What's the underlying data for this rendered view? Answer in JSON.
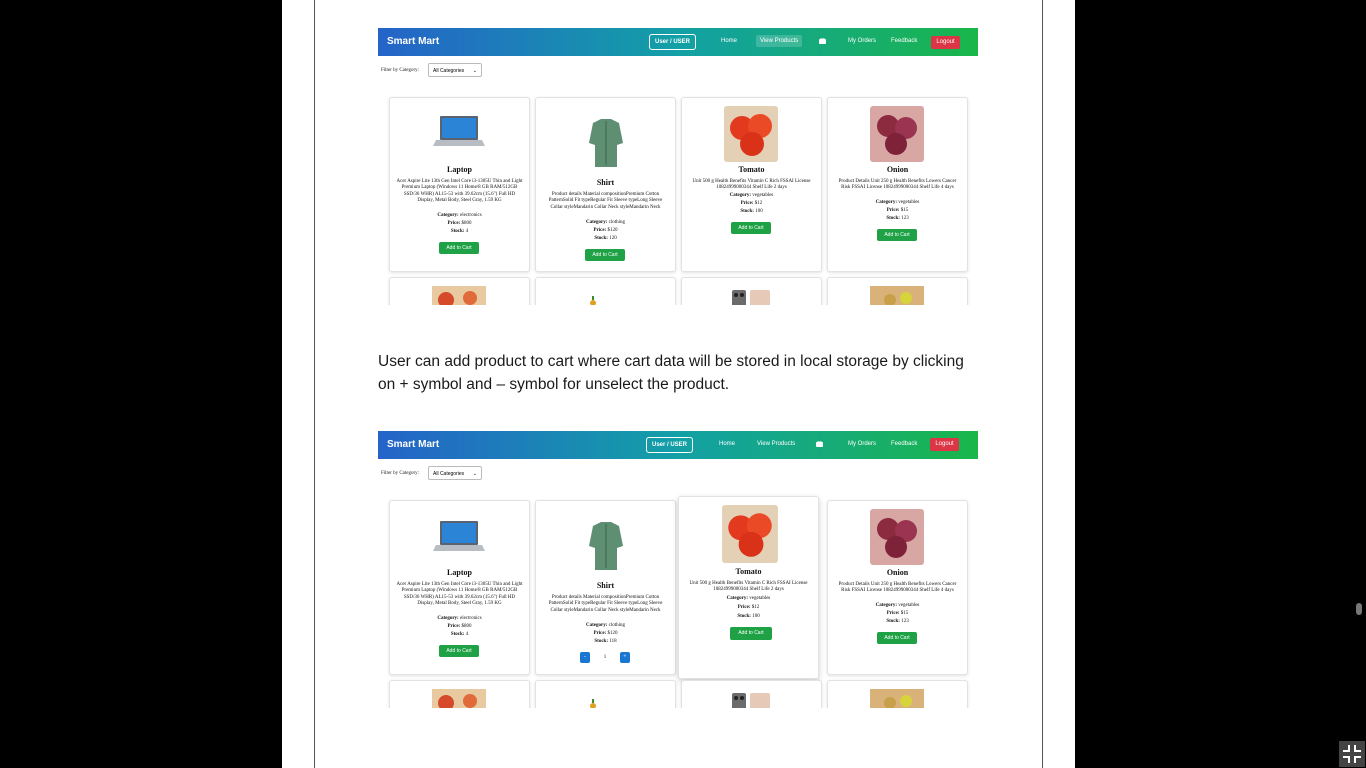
{
  "paragraph": {
    "line1": "User can add product to cart where cart data will be stored in local storage by clicking",
    "line2": "on + symbol and – symbol for unselect the product."
  },
  "colors": {
    "nav_gradient": [
      "#2563c9",
      "#13a0a6",
      "#19b64a"
    ],
    "add_to_cart": "#1fa246",
    "logout": "#dc3545",
    "qty_button": "#1976d2"
  },
  "screenshots": [
    {
      "brand": "Smart Mart",
      "nav_user": "User / USER",
      "nav_home": "Home",
      "nav_view_products": "View Products",
      "nav_my_orders": "My Orders",
      "nav_feedback": "Feedback",
      "nav_logout": "Logout",
      "filter_label": "Filter by Category:",
      "filter_value": "All Categories",
      "products": [
        {
          "name": "Laptop",
          "desc": "Acer Aspire Lite 13th Gen Intel Core i3-1305U Thin and Light Premium Laptop (Windows 11 Home/8 GB RAM/512GB SSD/36 WHR) AL15-53 with 39.62cm (15.6\") Full HD Display, Metal Body, Steel Gray, 1.59 KG",
          "category_label": "Category:",
          "category": "electronics",
          "price_label": "Price:",
          "price": "$800",
          "stock_label": "Stock:",
          "stock": "4",
          "button": "Add to Cart"
        },
        {
          "name": "Shirt",
          "desc": "Product details Material compositionPremium Cotton PatternSolid Fit typeRegular Fit Sleeve typeLong Sleeve Collar styleMandarin Collar Neck styleMandarin Neck",
          "category_label": "Category:",
          "category": "clothing",
          "price_label": "Price:",
          "price": "$120",
          "stock_label": "Stock:",
          "stock": "120",
          "button": "Add to Cart"
        },
        {
          "name": "Tomato",
          "desc": "Unit 500 g Health Benefits Vitamin C Rich FSSAI License 10824999000344 Shelf Life 2 days",
          "category_label": "Category:",
          "category": "vegetables",
          "price_label": "Price:",
          "price": "$12",
          "stock_label": "Stock:",
          "stock": "100",
          "button": "Add to Cart"
        },
        {
          "name": "Onion",
          "desc": "Product Details Unit 250 g Health Benefits Lowers Cancer Risk FSSAI License 10824999000344 Shelf Life 4 days",
          "category_label": "Category:",
          "category": "vegetables",
          "price_label": "Price:",
          "price": "$15",
          "stock_label": "Stock:",
          "stock": "123",
          "button": "Add to Cart"
        }
      ]
    },
    {
      "brand": "Smart Mart",
      "nav_user": "User / USER",
      "nav_home": "Home",
      "nav_view_products": "View Products",
      "nav_my_orders": "My Orders",
      "nav_feedback": "Feedback",
      "nav_logout": "Logout",
      "filter_label": "Filter by Category:",
      "filter_value": "All Categories",
      "products": [
        {
          "name": "Laptop",
          "desc": "Acer Aspire Lite 13th Gen Intel Core i3-1305U Thin and Light Premium Laptop (Windows 11 Home/8 GB RAM/512GB SSD/36 WHR) AL15-53 with 39.62cm (15.6\") Full HD Display, Metal Body, Steel Gray, 1.59 KG",
          "category_label": "Category:",
          "category": "electronics",
          "price_label": "Price:",
          "price": "$800",
          "stock_label": "Stock:",
          "stock": "4",
          "button": "Add to Cart"
        },
        {
          "name": "Shirt",
          "desc": "Product details Material compositionPremium Cotton PatternSolid Fit typeRegular Fit Sleeve typeLong Sleeve Collar styleMandarin Collar Neck styleMandarin Neck",
          "category_label": "Category:",
          "category": "clothing",
          "price_label": "Price:",
          "price": "$120",
          "stock_label": "Stock:",
          "stock": "118",
          "qty_minus": "-",
          "qty_value": "1",
          "qty_plus": "+"
        },
        {
          "name": "Tomato",
          "desc": "Unit 500 g Health Benefits Vitamin C Rich FSSAI License 10824999000344 Shelf Life 2 days",
          "category_label": "Category:",
          "category": "vegetables",
          "price_label": "Price:",
          "price": "$12",
          "stock_label": "Stock:",
          "stock": "100",
          "button": "Add to Cart"
        },
        {
          "name": "Onion",
          "desc": "Product Details Unit 250 g Health Benefits Lowers Cancer Risk FSSAI License 10824999000344 Shelf Life 4 days",
          "category_label": "Category:",
          "category": "vegetables",
          "price_label": "Price:",
          "price": "$15",
          "stock_label": "Stock:",
          "stock": "123",
          "button": "Add to Cart"
        }
      ]
    }
  ]
}
